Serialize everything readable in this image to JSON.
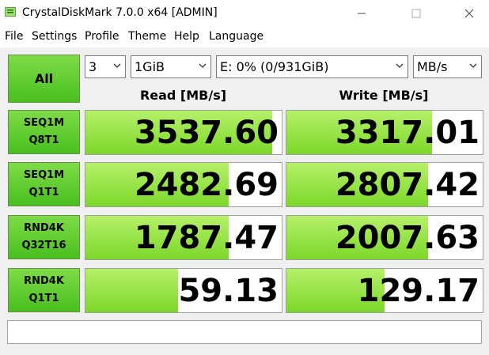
{
  "window": {
    "title": "CrystalDiskMark 7.0.0 x64 [ADMIN]",
    "controls": [
      "minimize",
      "maximize",
      "close"
    ]
  },
  "menu": {
    "items": [
      "File",
      "Settings",
      "Profile",
      "Theme",
      "Help",
      "Language"
    ]
  },
  "toolbar": {
    "all_label": "All",
    "count_value": "3",
    "size_value": "1GiB",
    "drive_value": "E: 0% (0/931GiB)",
    "unit_value": "MB/s"
  },
  "headers": {
    "read": "Read [MB/s]",
    "write": "Write [MB/s]"
  },
  "tests": [
    {
      "line1": "SEQ1M",
      "line2": "Q8T1",
      "read": "3537.60",
      "write": "3317.01",
      "read_fill": 0.95,
      "write_fill": 0.74
    },
    {
      "line1": "SEQ1M",
      "line2": "Q1T1",
      "read": "2482.69",
      "write": "2807.42",
      "read_fill": 0.73,
      "write_fill": 0.72
    },
    {
      "line1": "RND4K",
      "line2": "Q32T16",
      "read": "1787.47",
      "write": "2007.63",
      "read_fill": 0.73,
      "write_fill": 0.72
    },
    {
      "line1": "RND4K",
      "line2": "Q1T1",
      "read": "59.13",
      "write": "129.17",
      "read_fill": 0.47,
      "write_fill": 0.5
    }
  ],
  "comment": {
    "value": ""
  },
  "colors": {
    "accent_green": "#49bf1f",
    "bar_green": "#7cd82a"
  }
}
